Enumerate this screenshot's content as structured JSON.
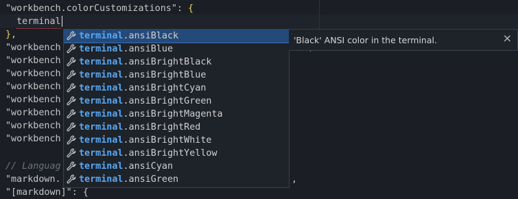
{
  "editor": {
    "lines": [
      {
        "prefix": "\"workbench.colorCustomizations\": ",
        "suffix": "{"
      },
      {
        "indent": "  ",
        "typed": "terminal"
      },
      {
        "text": "},"
      },
      {
        "text": "\"workbench"
      },
      {
        "text": "\"workbench"
      },
      {
        "text": "\"workbench"
      },
      {
        "text": "\"workbench"
      },
      {
        "text": "\"workbench"
      },
      {
        "text": "\"workbench"
      },
      {
        "text": "\"workbench"
      },
      {
        "text": "\"workbench"
      },
      {
        "text": ""
      },
      {
        "comment": "// Languag"
      },
      {
        "text": "\"markdown."
      },
      {
        "text": "\"[markdown]\": {"
      }
    ],
    "right_fragments": {
      "line4": "lse,",
      "line14": ","
    }
  },
  "suggest": {
    "match_prefix": "terminal",
    "items": [
      {
        "rest": ".ansiBlack"
      },
      {
        "rest": ".ansiBlue"
      },
      {
        "rest": ".ansiBrightBlack"
      },
      {
        "rest": ".ansiBrightBlue"
      },
      {
        "rest": ".ansiBrightCyan"
      },
      {
        "rest": ".ansiBrightGreen"
      },
      {
        "rest": ".ansiBrightMagenta"
      },
      {
        "rest": ".ansiBrightRed"
      },
      {
        "rest": ".ansiBrightWhite"
      },
      {
        "rest": ".ansiBrightYellow"
      },
      {
        "rest": ".ansiCyan"
      },
      {
        "rest": ".ansiGreen"
      }
    ],
    "selected_index": 0,
    "item_icon": "wrench-icon",
    "details_text": "'Black' ANSI color in the terminal.",
    "close_glyph": "×"
  },
  "colors": {
    "background": "#1b1e24",
    "match": "#57a8f5",
    "selection": "#244a7a",
    "brace": "#e8d36a"
  }
}
